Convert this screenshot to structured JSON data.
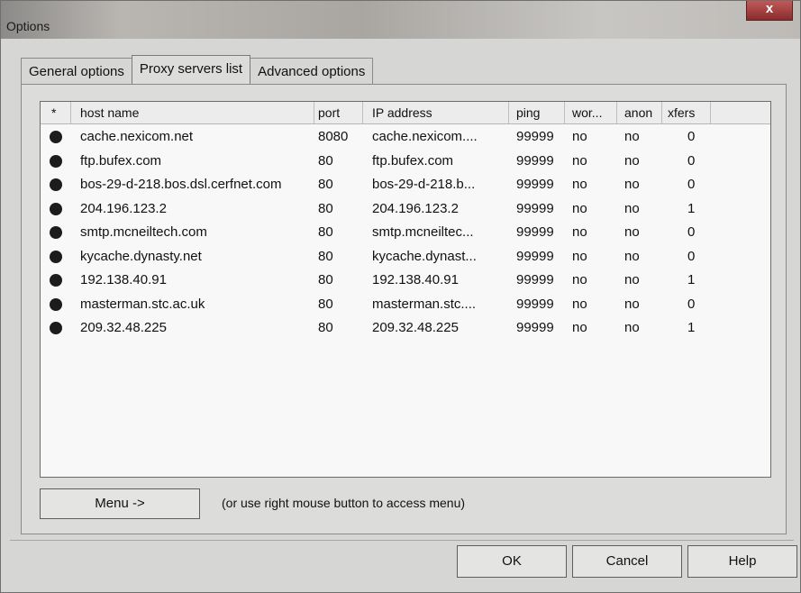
{
  "window": {
    "title": "Options",
    "close_glyph": "x"
  },
  "tabs": [
    {
      "label": "General options",
      "active": false
    },
    {
      "label": "Proxy servers list",
      "active": true
    },
    {
      "label": "Advanced options",
      "active": false
    }
  ],
  "proxy_list": {
    "columns": [
      "*",
      "host name",
      "port",
      "IP address",
      "ping",
      "wor...",
      "anon",
      "xfers"
    ],
    "status_icon": "filled-circle-icon",
    "rows": [
      {
        "host": "cache.nexicom.net",
        "port": "8080",
        "ip": "cache.nexicom....",
        "ping": "99999",
        "working": "no",
        "anon": "no",
        "xfers": "0"
      },
      {
        "host": "ftp.bufex.com",
        "port": "80",
        "ip": "ftp.bufex.com",
        "ping": "99999",
        "working": "no",
        "anon": "no",
        "xfers": "0"
      },
      {
        "host": "bos-29-d-218.bos.dsl.cerfnet.com",
        "port": "80",
        "ip": "bos-29-d-218.b...",
        "ping": "99999",
        "working": "no",
        "anon": "no",
        "xfers": "0"
      },
      {
        "host": "204.196.123.2",
        "port": "80",
        "ip": "204.196.123.2",
        "ping": "99999",
        "working": "no",
        "anon": "no",
        "xfers": "1"
      },
      {
        "host": "smtp.mcneiltech.com",
        "port": "80",
        "ip": "smtp.mcneiltec...",
        "ping": "99999",
        "working": "no",
        "anon": "no",
        "xfers": "0"
      },
      {
        "host": "kycache.dynasty.net",
        "port": "80",
        "ip": "kycache.dynast...",
        "ping": "99999",
        "working": "no",
        "anon": "no",
        "xfers": "0"
      },
      {
        "host": "192.138.40.91",
        "port": "80",
        "ip": "192.138.40.91",
        "ping": "99999",
        "working": "no",
        "anon": "no",
        "xfers": "1"
      },
      {
        "host": "masterman.stc.ac.uk",
        "port": "80",
        "ip": "masterman.stc....",
        "ping": "99999",
        "working": "no",
        "anon": "no",
        "xfers": "0"
      },
      {
        "host": "209.32.48.225",
        "port": "80",
        "ip": "209.32.48.225",
        "ping": "99999",
        "working": "no",
        "anon": "no",
        "xfers": "1"
      }
    ]
  },
  "menu": {
    "button_label": "Menu ->",
    "hint": "(or use right mouse button to access menu)"
  },
  "buttons": {
    "ok": "OK",
    "cancel": "Cancel",
    "help": "Help"
  }
}
